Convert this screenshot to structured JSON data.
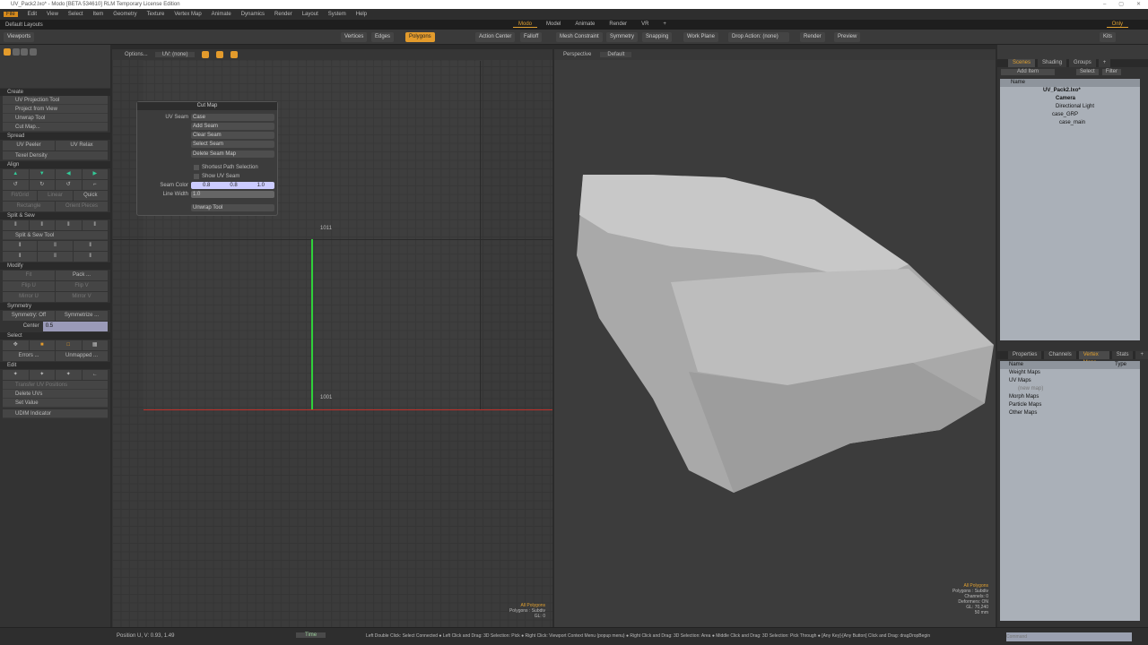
{
  "title": "UV_Pack2.lxo* - Modo [BETA 534610] RLM Temporary License Edition",
  "menu": [
    "File",
    "Edit",
    "View",
    "Select",
    "Item",
    "Geometry",
    "Texture",
    "Vertex Map",
    "Animate",
    "Dynamics",
    "Render",
    "Layout",
    "System",
    "Help"
  ],
  "layouts": {
    "label": "Default Layouts",
    "tabs": [
      "Modo",
      "Model",
      "Animate",
      "Render",
      "VR",
      "+"
    ],
    "only": "Only"
  },
  "toolbar": {
    "viewports": "Viewports",
    "vertices": "Vertices",
    "edges": "Edges",
    "polygons": "Polygons",
    "action_center": "Action Center",
    "falloff": "Falloff",
    "mesh_constraint": "Mesh Constraint",
    "symmetry": "Symmetry",
    "snapping": "Snapping",
    "work_plane": "Work Plane",
    "drop_action": "Drop Action: (none)",
    "render": "Render",
    "preview": "Preview",
    "kits": "Kits"
  },
  "left": {
    "create": "Create",
    "create_items": [
      "UV Projection Tool",
      "Project from View",
      "Unwrap Tool",
      "Cut Map..."
    ],
    "spread": "Spread",
    "uv_peeler": "UV Peeler",
    "uv_relax": "UV Relax",
    "texel_density": "Texel Density",
    "align": "Align",
    "fit_items": [
      "Fit/Grid",
      "Linear",
      "Quick"
    ],
    "rect_items": [
      "Rectangle",
      "Orient Pieces"
    ],
    "split_sew": "Split & Sew",
    "split_sew_tool": "Split & Sew Tool",
    "modify": "Modify",
    "fit": "Fit",
    "pack": "Pack ...",
    "flip": [
      "Flip U",
      "Flip V"
    ],
    "mirror": [
      "Mirror U",
      "Mirror V"
    ],
    "symmetry": "Symmetry",
    "symmetry_off": "Symmetry: Off",
    "symmetrize": "Symmetrize ...",
    "center_label": "Center",
    "center_value": "0.5",
    "select": "Select",
    "errors": "Errors ...",
    "unmapped": "Unmapped ...",
    "edit": "Edit",
    "edit_items": [
      "Transfer UV Positions",
      "Delete UVs",
      "Set Value"
    ],
    "udim": "UDIM Indicator"
  },
  "uv": {
    "options": "Options...",
    "uv_map": "UV: (none)",
    "tile_upper": "1011",
    "tile_lower": "1001",
    "info": [
      "All Polygons",
      "Polygons : Subdiv",
      "GL: 0"
    ]
  },
  "cutmap": {
    "title": "Cut Map",
    "uv_seam_label": "UV Seam",
    "uv_seam_value": "Case",
    "buttons": [
      "Add Seam",
      "Clear Seam",
      "Select Seam",
      "Delete Seam Map"
    ],
    "shortest_path": "Shortest Path Selection",
    "show_uv_seam": "Show UV Seam",
    "seam_color_label": "Seam Color",
    "seam_color": [
      "0.8",
      "0.8",
      "1.0"
    ],
    "line_width_label": "Line Width",
    "line_width": "1.0",
    "unwrap": "Unwrap Tool"
  },
  "view3d": {
    "projection": "Perspective",
    "style": "Default",
    "info": [
      "All Polygons",
      "Polygons : Subdiv",
      "Channels: 0",
      "Deformers: ON",
      "GL: 70,240",
      "50 mm"
    ]
  },
  "scene": {
    "tabs": [
      "Scenes",
      "Shading",
      "Groups",
      "+"
    ],
    "add_item": "Add Item",
    "select": "Select",
    "filter": "Filter",
    "name_col": "Name",
    "items": [
      "UV_Pack2.lxo*",
      "Camera",
      "Directional Light",
      "case_GRP",
      "case_main"
    ]
  },
  "vmaps": {
    "tabs": [
      "Properties",
      "Channels",
      "Vertex Maps",
      "Stats",
      "+"
    ],
    "name_col": "Name",
    "type_col": "Type",
    "items": [
      "Weight Maps",
      "UV Maps",
      "(new map)",
      "Morph Maps",
      "Particle Maps",
      "Other Maps"
    ]
  },
  "status": {
    "position": "Position U, V:   0.93, 1.49",
    "time": "Time",
    "hints": "Left Double Click: Select Connected ● Left Click and Drag: 3D Selection: Pick ● Right Click: Viewport Context Menu (popup menu) ● Right Click and Drag: 3D Selection: Area ● Middle Click and Drag: 3D Selection: Pick Through ● [Any Key]-[Any Button] Click and Drag: dragDropBegin",
    "command_placeholder": "Command"
  },
  "colors": {
    "accent": "#e39b2c",
    "seam": "#ccccff"
  }
}
